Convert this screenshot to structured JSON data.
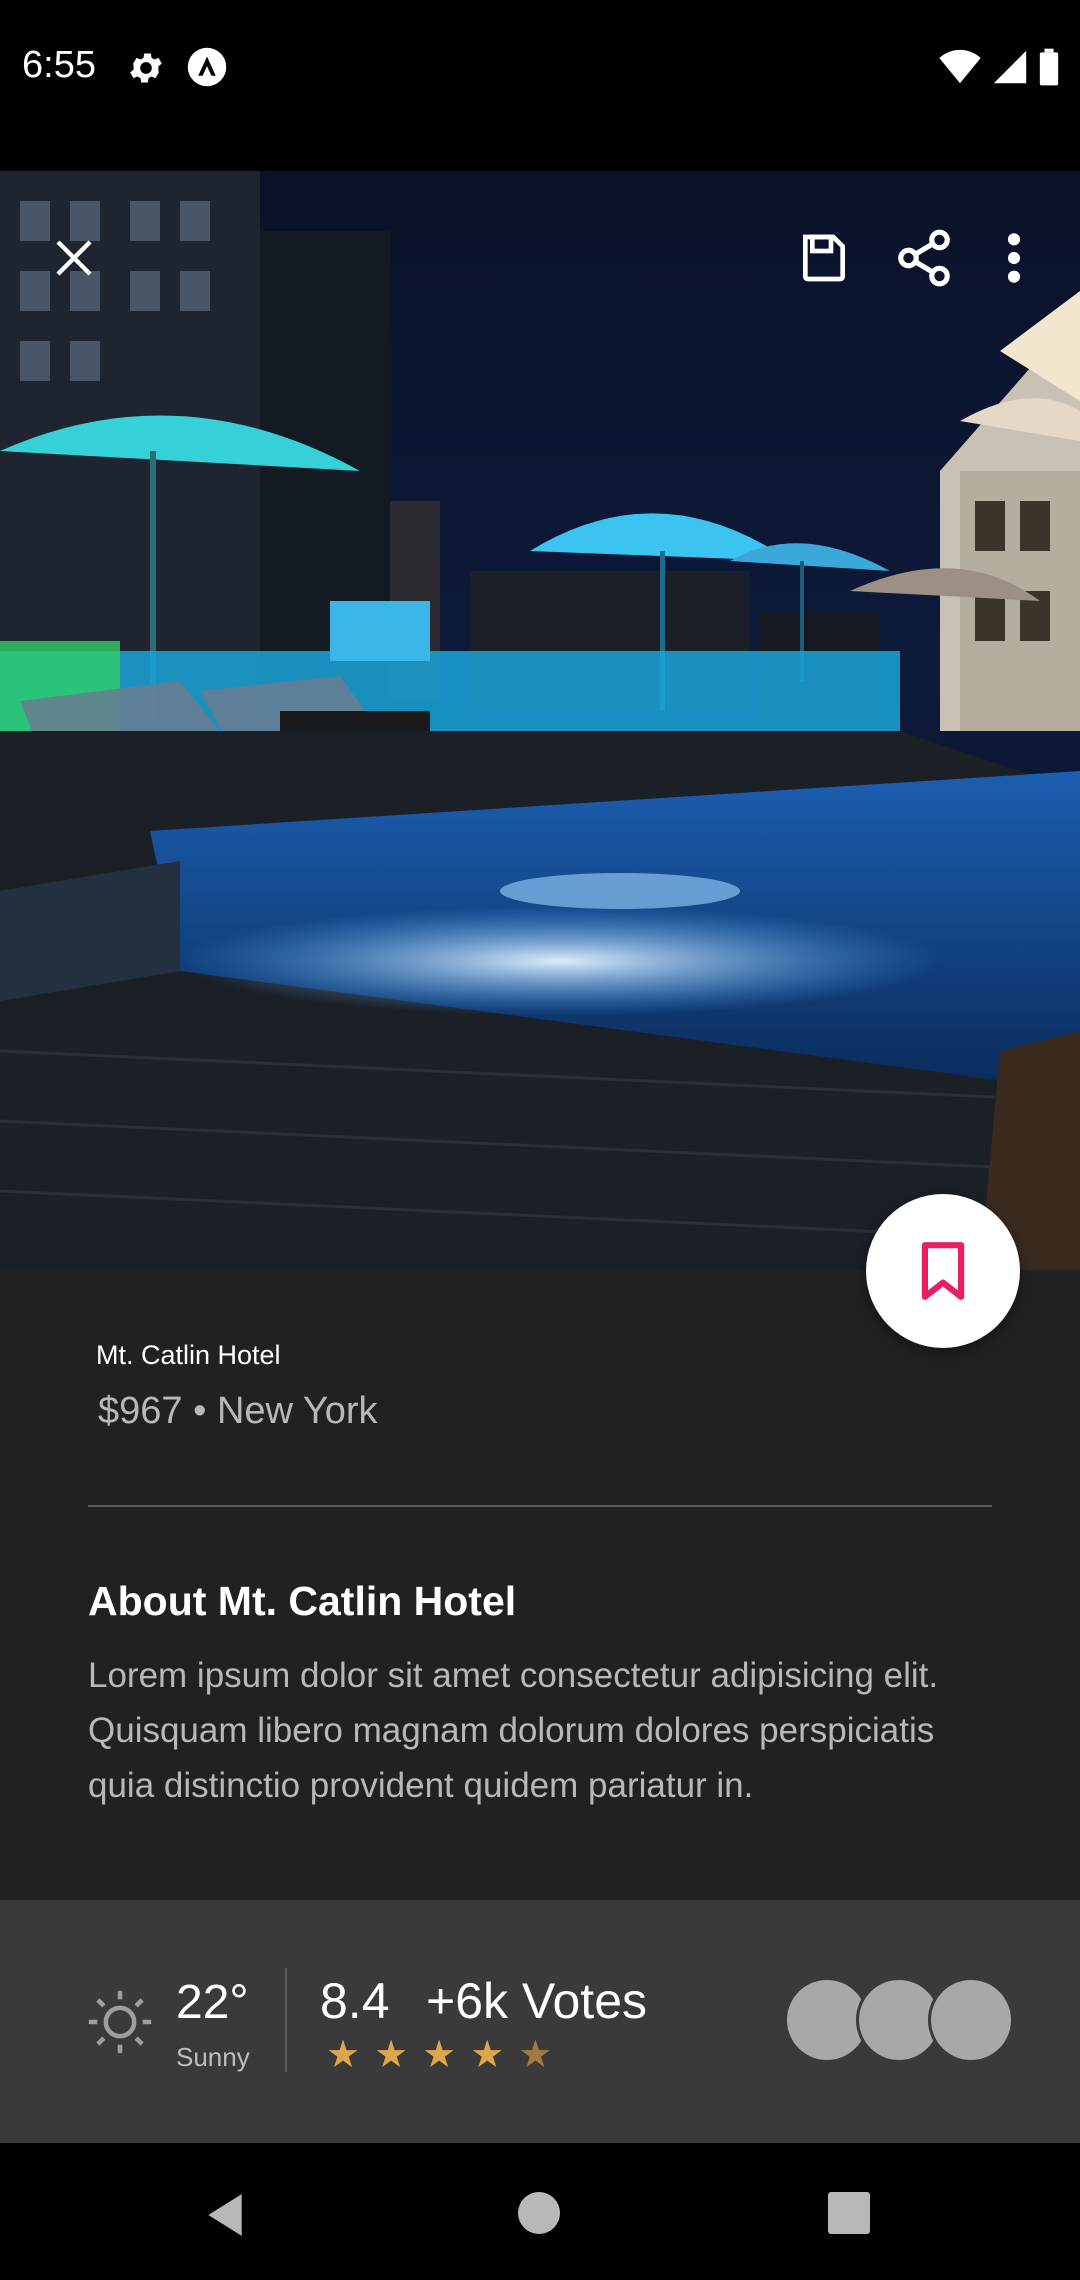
{
  "status_bar": {
    "time": "6:55"
  },
  "icons": {
    "close": "close-icon",
    "save": "save-icon",
    "share": "share-icon",
    "more": "more-vertical-icon",
    "bookmark": "bookmark-icon",
    "weather": "sun-icon"
  },
  "hotel": {
    "name": "Mt. Catlin Hotel",
    "subtitle": "$967 • New York"
  },
  "about": {
    "title": "About Mt. Catlin Hotel",
    "body": " Lorem ipsum dolor sit amet consectetur adipisicing elit. Quisquam libero magnam dolorum dolores perspiciatis quia distinctio provident quidem pariatur in."
  },
  "weather": {
    "temperature": "22°",
    "condition": "Sunny"
  },
  "rating": {
    "score": "8.4",
    "votes": "+6k Votes",
    "stars": 4.5
  },
  "colors": {
    "accent": "#e91e63",
    "background": "#212121",
    "panel": "#3a3a3a",
    "star": "#e0a44a"
  }
}
